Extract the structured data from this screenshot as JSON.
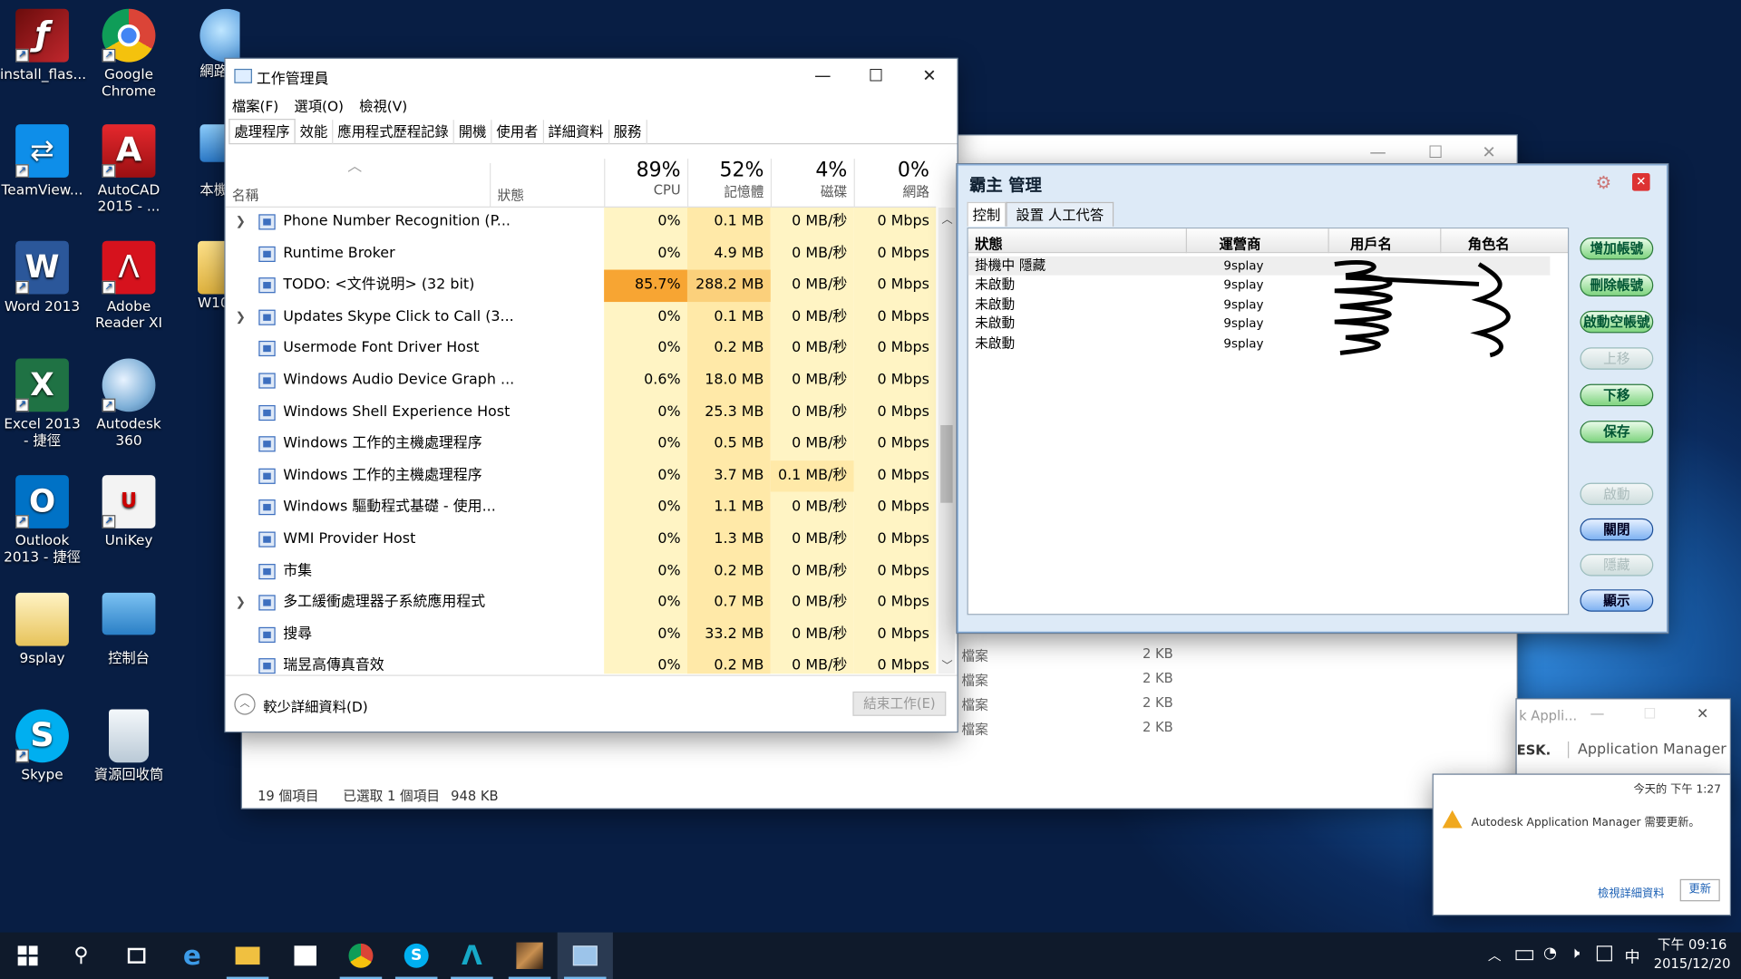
{
  "desktop": {
    "icons": [
      {
        "label": "install_flas...",
        "icon": "flash-installer-icon"
      },
      {
        "label": "Google Chrome",
        "icon": "chrome-icon"
      },
      {
        "label": "網路",
        "icon": "network-icon"
      },
      {
        "label": "TeamView...",
        "icon": "teamviewer-icon"
      },
      {
        "label": "AutoCAD 2015 - ...",
        "icon": "autocad-icon"
      },
      {
        "label": "本機",
        "icon": "this-pc-icon"
      },
      {
        "label": "Word 2013",
        "icon": "word-icon"
      },
      {
        "label": "Adobe Reader XI",
        "icon": "adobe-reader-icon"
      },
      {
        "label": "W10",
        "icon": "folder-icon"
      },
      {
        "label": "Excel 2013 - 捷徑",
        "icon": "excel-icon"
      },
      {
        "label": "Autodesk 360",
        "icon": "autodesk-360-icon"
      },
      {
        "label": "Outlook 2013 - 捷徑",
        "icon": "outlook-icon"
      },
      {
        "label": "UniKey",
        "icon": "unikey-icon"
      },
      {
        "label": "9splay",
        "icon": "folder-icon"
      },
      {
        "label": "控制台",
        "icon": "control-panel-icon"
      },
      {
        "label": "Skype",
        "icon": "skype-icon"
      },
      {
        "label": "資源回收筒",
        "icon": "recycle-bin-icon"
      }
    ]
  },
  "taskmgr": {
    "title": "工作管理員",
    "menu": [
      "檔案(F)",
      "選項(O)",
      "檢視(V)"
    ],
    "tabs": [
      "處理程序",
      "效能",
      "應用程式歷程記錄",
      "開機",
      "使用者",
      "詳細資料",
      "服務"
    ],
    "columns": {
      "name": "名稱",
      "status": "狀態",
      "cpu_pct": "89%",
      "cpu": "CPU",
      "mem_pct": "52%",
      "mem": "記憶體",
      "disk_pct": "4%",
      "disk": "磁碟",
      "net_pct": "0%",
      "net": "網路"
    },
    "rows": [
      {
        "name": "Phone Number Recognition (P...",
        "expand": true,
        "cpu": "0%",
        "mem": "0.1 MB",
        "disk": "0 MB/秒",
        "net": "0 Mbps"
      },
      {
        "name": "Runtime Broker",
        "expand": false,
        "cpu": "0%",
        "mem": "4.9 MB",
        "disk": "0 MB/秒",
        "net": "0 Mbps"
      },
      {
        "name": "TODO: <文件说明> (32 bit)",
        "expand": false,
        "cpu": "85.7%",
        "mem": "288.2 MB",
        "disk": "0 MB/秒",
        "net": "0 Mbps"
      },
      {
        "name": "Updates Skype Click to Call (3...",
        "expand": true,
        "cpu": "0%",
        "mem": "0.1 MB",
        "disk": "0 MB/秒",
        "net": "0 Mbps"
      },
      {
        "name": "Usermode Font Driver Host",
        "expand": false,
        "cpu": "0%",
        "mem": "0.2 MB",
        "disk": "0 MB/秒",
        "net": "0 Mbps"
      },
      {
        "name": "Windows Audio Device Graph ...",
        "expand": false,
        "cpu": "0.6%",
        "mem": "18.0 MB",
        "disk": "0 MB/秒",
        "net": "0 Mbps"
      },
      {
        "name": "Windows Shell Experience Host",
        "expand": false,
        "cpu": "0%",
        "mem": "25.3 MB",
        "disk": "0 MB/秒",
        "net": "0 Mbps"
      },
      {
        "name": "Windows 工作的主機處理程序",
        "expand": false,
        "cpu": "0%",
        "mem": "0.5 MB",
        "disk": "0 MB/秒",
        "net": "0 Mbps"
      },
      {
        "name": "Windows 工作的主機處理程序",
        "expand": false,
        "cpu": "0%",
        "mem": "3.7 MB",
        "disk": "0.1 MB/秒",
        "net": "0 Mbps"
      },
      {
        "name": "Windows 驅動程式基礎 - 使用...",
        "expand": false,
        "cpu": "0%",
        "mem": "1.1 MB",
        "disk": "0 MB/秒",
        "net": "0 Mbps"
      },
      {
        "name": "WMI Provider Host",
        "expand": false,
        "cpu": "0%",
        "mem": "1.3 MB",
        "disk": "0 MB/秒",
        "net": "0 Mbps"
      },
      {
        "name": "市集",
        "expand": false,
        "cpu": "0%",
        "mem": "0.2 MB",
        "disk": "0 MB/秒",
        "net": "0 Mbps"
      },
      {
        "name": "多工緩衝處理器子系統應用程式",
        "expand": true,
        "cpu": "0%",
        "mem": "0.7 MB",
        "disk": "0 MB/秒",
        "net": "0 Mbps"
      },
      {
        "name": "搜尋",
        "expand": false,
        "cpu": "0%",
        "mem": "33.2 MB",
        "disk": "0 MB/秒",
        "net": "0 Mbps"
      },
      {
        "name": "瑞昱高傳真音效",
        "expand": false,
        "cpu": "0%",
        "mem": "0.2 MB",
        "disk": "0 MB/秒",
        "net": "0 Mbps"
      }
    ],
    "fewer_details": "較少詳細資料(D)",
    "end_task": "結束工作(E)"
  },
  "explorer": {
    "file_rows": [
      {
        "type": "檔案",
        "size": "2 KB"
      },
      {
        "type": "檔案",
        "size": "2 KB"
      },
      {
        "type": "檔案",
        "size": "2 KB"
      },
      {
        "type": "檔案",
        "size": "2 KB"
      }
    ],
    "item_count": "19 個項目",
    "selected": "已選取 1 個項目",
    "selected_size": "948 KB"
  },
  "bazhu": {
    "title": "霸主 管理",
    "tabs": [
      "控制",
      "設置 人工代答"
    ],
    "columns": [
      "狀態",
      "運營商",
      "用戶名",
      "角色名"
    ],
    "rows": [
      {
        "status": "掛機中 隱藏",
        "operator": "9splay"
      },
      {
        "status": "未啟動",
        "operator": "9splay"
      },
      {
        "status": "未啟動",
        "operator": "9splay"
      },
      {
        "status": "未啟動",
        "operator": "9splay"
      },
      {
        "status": "未啟動",
        "operator": "9splay"
      }
    ],
    "buttons": [
      {
        "label": "增加帳號",
        "state": "green"
      },
      {
        "label": "刪除帳號",
        "state": "green"
      },
      {
        "label": "啟動空帳號",
        "state": "green"
      },
      {
        "label": "上移",
        "state": "disabled"
      },
      {
        "label": "下移",
        "state": "green"
      },
      {
        "label": "保存",
        "state": "green"
      },
      {
        "label": "啟動",
        "state": "disabled"
      },
      {
        "label": "關閉",
        "state": "blue"
      },
      {
        "label": "隱藏",
        "state": "disabled"
      },
      {
        "label": "顯示",
        "state": "blue"
      }
    ]
  },
  "autodesk": {
    "title": "k Appli...",
    "brand": "ESK.",
    "app": "Application Manager",
    "time": "今天的 下午 1:27",
    "message": "Autodesk Application Manager 需要更新。",
    "details_link": "檢視詳細資料",
    "update_button": "更新"
  },
  "taskbar": {
    "clock_time": "下午 09:16",
    "clock_date": "2015/12/20",
    "ime": "中",
    "apps": [
      "edge-icon",
      "file-explorer-icon",
      "store-icon",
      "chrome-icon",
      "skype-icon",
      "autodesk-icon",
      "game-icon",
      "task-manager-icon"
    ]
  }
}
